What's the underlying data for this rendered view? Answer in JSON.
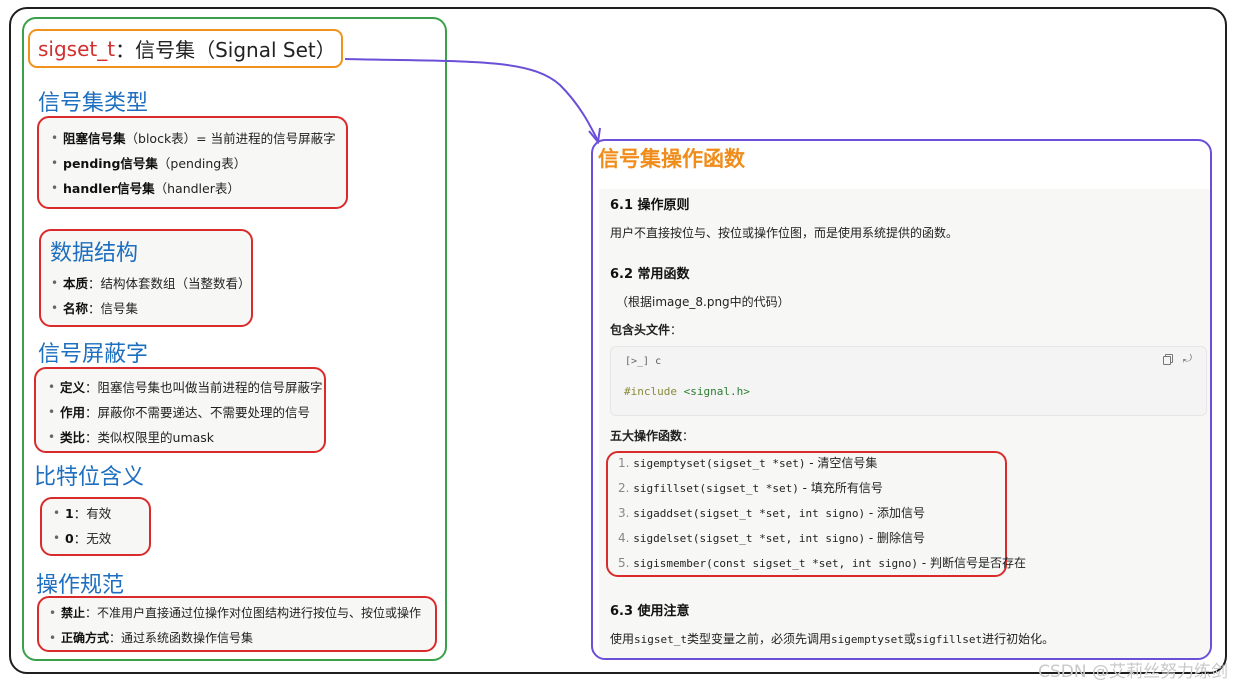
{
  "left": {
    "title_prefix": "sigset_t",
    "title_suffix": "：信号集（Signal Set）",
    "sections": [
      {
        "heading": "信号集类型",
        "items": [
          {
            "label": "阻塞信号集",
            "text": "（block表）= 当前进程的信号屏蔽字"
          },
          {
            "label": "pending信号集",
            "text": "（pending表）"
          },
          {
            "label": "handler信号集",
            "text": "（handler表）"
          }
        ]
      },
      {
        "heading": "数据结构",
        "items": [
          {
            "label": "本质",
            "text": "：结构体套数组（当整数看）"
          },
          {
            "label": "名称",
            "text": "：信号集"
          }
        ]
      },
      {
        "heading": "信号屏蔽字",
        "items": [
          {
            "label": "定义",
            "text": "：阻塞信号集也叫做当前进程的信号屏蔽字"
          },
          {
            "label": "作用",
            "text": "：屏蔽你不需要递达、不需要处理的信号"
          },
          {
            "label": "类比",
            "text": "：类似权限里的umask"
          }
        ]
      },
      {
        "heading": "比特位含义",
        "items": [
          {
            "label": "1",
            "text": "：有效"
          },
          {
            "label": "0",
            "text": "：无效"
          }
        ]
      },
      {
        "heading": "操作规范",
        "items": [
          {
            "label": "禁止",
            "text": "：不准用户直接通过位操作对位图结构进行按位与、按位或操作"
          },
          {
            "label": "正确方式",
            "text": "：通过系统函数操作信号集"
          }
        ]
      }
    ]
  },
  "right": {
    "title": "信号集操作函数",
    "s1_heading": "6.1 操作原则",
    "s1_text": "用户不直接按位与、按位或操作位图，而是使用系统提供的函数。",
    "s2_heading": "6.2 常用函数",
    "s2_note": "（根据image_8.png中的代码）",
    "include_label": "包含头文件",
    "include_colon": "：",
    "code_lang_icon": "[>_]",
    "code_lang": "c",
    "code_directive": "#include",
    "code_header": "<signal.h>",
    "five_label": "五大操作函数",
    "five_colon": "：",
    "functions": [
      {
        "num": "1.",
        "sig": "sigemptyset(sigset_t *set)",
        "desc": " - 清空信号集"
      },
      {
        "num": "2.",
        "sig": "sigfillset(sigset_t *set)",
        "desc": " - 填充所有信号"
      },
      {
        "num": "3.",
        "sig": "sigaddset(sigset_t *set, int signo)",
        "desc": " - 添加信号"
      },
      {
        "num": "4.",
        "sig": "sigdelset(sigset_t *set, int signo)",
        "desc": " - 删除信号"
      },
      {
        "num": "5.",
        "sig": "sigismember(const sigset_t *set, int signo)",
        "desc": " - 判断信号是否存在"
      }
    ],
    "s3_heading": "6.3 使用注意",
    "s3_pre": "使用",
    "s3_code1": "sigset_t",
    "s3_mid1": "类型变量之前，必须先调用",
    "s3_code2": "sigemptyset",
    "s3_mid2": "或",
    "s3_code3": "sigfillset",
    "s3_post": "进行初始化。"
  },
  "watermark": "CSDN @艾莉丝努力练剑",
  "colors": {
    "left_border": "#3aa14a",
    "title_border": "#f0921b",
    "heading": "#1e6fbf",
    "red_box": "#d92b2b",
    "right_border": "#6b4fd8",
    "right_title": "#f08c1a",
    "arrow": "#6b4fd8"
  }
}
